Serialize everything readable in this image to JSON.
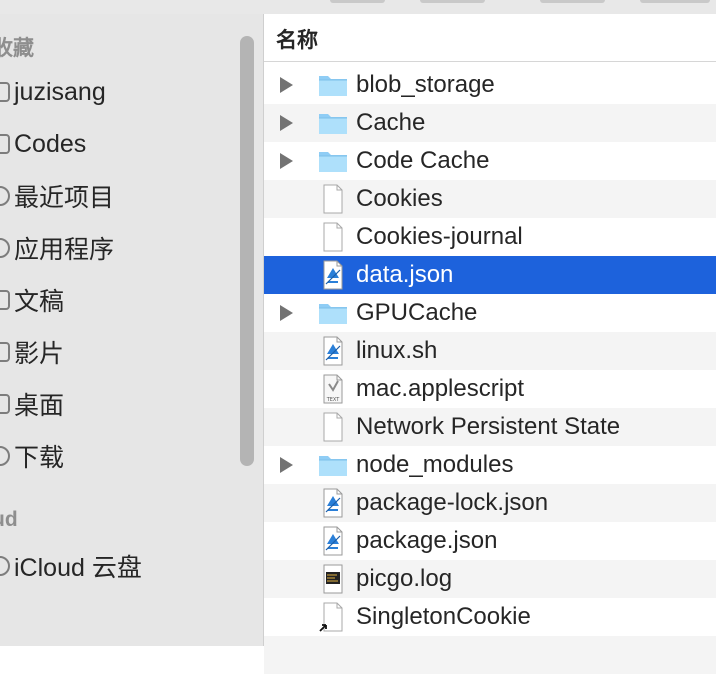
{
  "sidebar": {
    "favorites_heading": "收藏",
    "icloud_heading": "ud",
    "items": [
      {
        "label": "juzisang",
        "icon": "home-icon"
      },
      {
        "label": "Codes",
        "icon": "folder-icon"
      },
      {
        "label": "最近项目",
        "icon": "clock-icon"
      },
      {
        "label": "应用程序",
        "icon": "applications-icon"
      },
      {
        "label": "文稿",
        "icon": "document-icon"
      },
      {
        "label": "影片",
        "icon": "film-icon"
      },
      {
        "label": "桌面",
        "icon": "desktop-icon"
      },
      {
        "label": "下载",
        "icon": "download-icon"
      }
    ],
    "icloud_items": [
      {
        "label": "iCloud 云盘",
        "icon": "cloud-icon"
      }
    ]
  },
  "list": {
    "column_name": "名称",
    "selected_color": "#1d62dc",
    "rows": [
      {
        "name": "blob_storage",
        "kind": "folder",
        "expandable": true
      },
      {
        "name": "Cache",
        "kind": "folder",
        "expandable": true
      },
      {
        "name": "Code Cache",
        "kind": "folder",
        "expandable": true
      },
      {
        "name": "Cookies",
        "kind": "file",
        "expandable": false
      },
      {
        "name": "Cookies-journal",
        "kind": "file",
        "expandable": false
      },
      {
        "name": "data.json",
        "kind": "script",
        "expandable": false,
        "selected": true
      },
      {
        "name": "GPUCache",
        "kind": "folder",
        "expandable": true
      },
      {
        "name": "linux.sh",
        "kind": "script",
        "expandable": false
      },
      {
        "name": "mac.applescript",
        "kind": "text",
        "expandable": false
      },
      {
        "name": "Network Persistent State",
        "kind": "file",
        "expandable": false
      },
      {
        "name": "node_modules",
        "kind": "folder",
        "expandable": true
      },
      {
        "name": "package-lock.json",
        "kind": "script",
        "expandable": false
      },
      {
        "name": "package.json",
        "kind": "script",
        "expandable": false
      },
      {
        "name": "picgo.log",
        "kind": "log",
        "expandable": false
      },
      {
        "name": "SingletonCookie",
        "kind": "alias",
        "expandable": false
      }
    ]
  }
}
